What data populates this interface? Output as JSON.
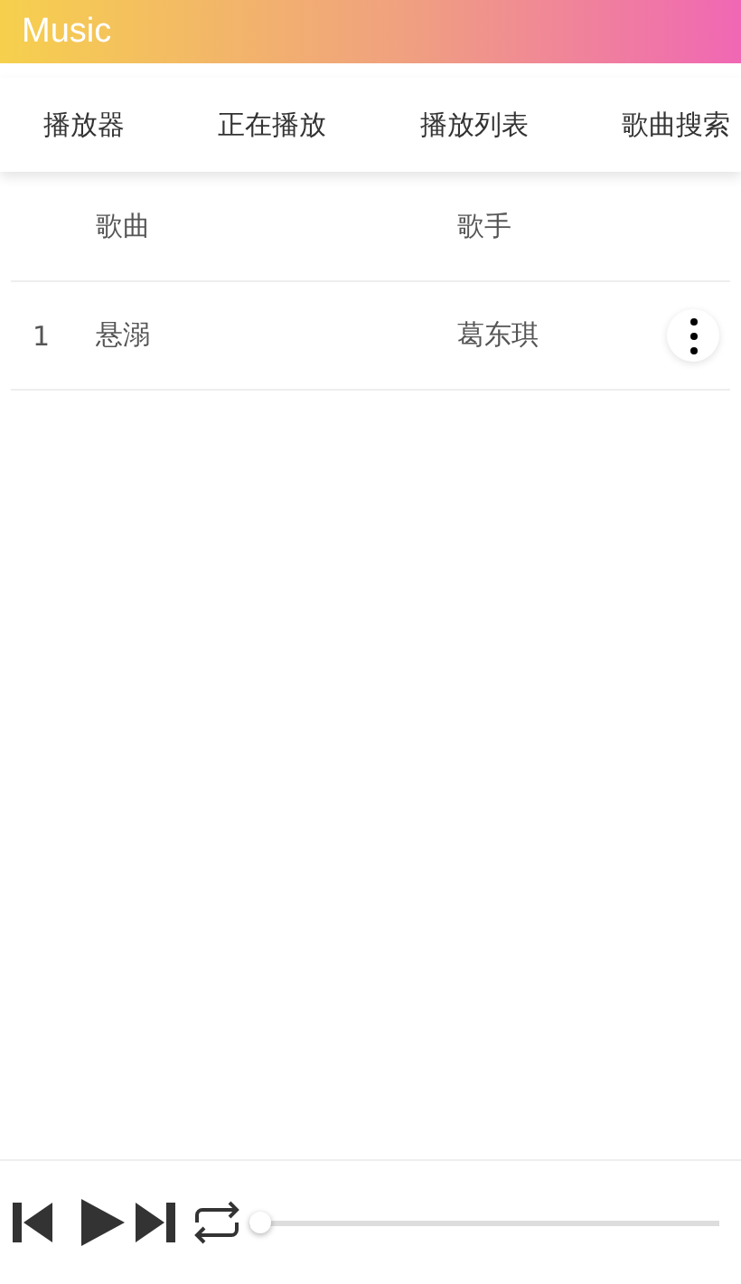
{
  "app_bar": {
    "title": "Music"
  },
  "tabs": [
    {
      "label": "播放器"
    },
    {
      "label": "正在播放"
    },
    {
      "label": "播放列表"
    },
    {
      "label": "歌曲搜索"
    }
  ],
  "table": {
    "columns": [
      "歌曲",
      "歌手"
    ],
    "rows": [
      {
        "index": "1",
        "song": "悬溺",
        "artist": "葛东琪"
      }
    ]
  },
  "player": {
    "level": 0
  }
}
